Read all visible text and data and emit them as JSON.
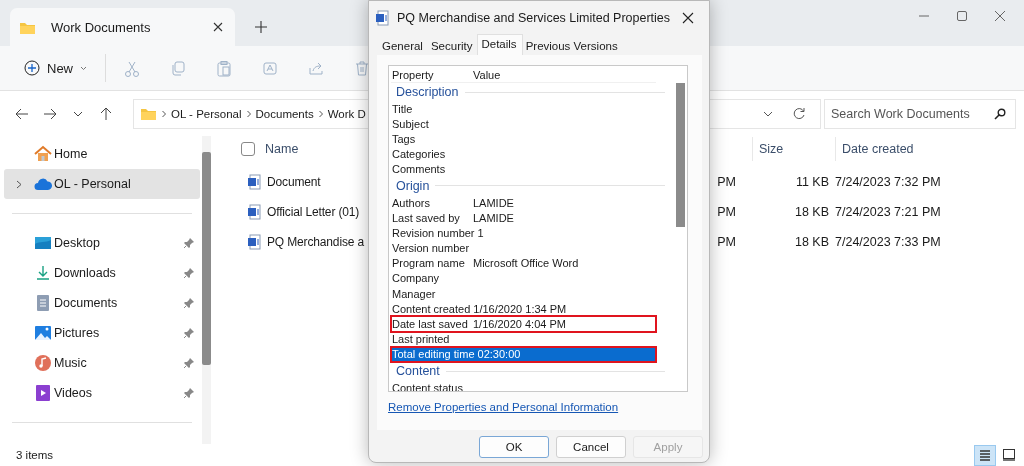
{
  "explorer": {
    "tab": {
      "title": "Work Documents"
    },
    "toolbar": {
      "new_label": "New",
      "actions": [
        {
          "kind": "cut",
          "disabled": true
        },
        {
          "kind": "copy",
          "disabled": true
        },
        {
          "kind": "paste",
          "disabled": true
        },
        {
          "kind": "rename",
          "disabled": true
        },
        {
          "kind": "share",
          "disabled": true
        },
        {
          "kind": "delete",
          "disabled": true
        }
      ]
    },
    "breadcrumbs": [
      "OL - Personal",
      "Documents",
      "Work D"
    ],
    "search": {
      "placeholder": "Search Work Documents"
    },
    "sidebar": {
      "sections": [
        {
          "items": [
            {
              "label": "Home",
              "kind": "home",
              "selected": false,
              "expandable": false,
              "pinned": false
            },
            {
              "label": "OL - Personal",
              "kind": "cloud",
              "selected": true,
              "expandable": true,
              "pinned": false
            }
          ]
        },
        {
          "items": [
            {
              "label": "Desktop",
              "kind": "desktop",
              "selected": false,
              "expandable": false,
              "pinned": true
            },
            {
              "label": "Downloads",
              "kind": "downloads",
              "selected": false,
              "expandable": false,
              "pinned": true
            },
            {
              "label": "Documents",
              "kind": "documents",
              "selected": false,
              "expandable": false,
              "pinned": true
            },
            {
              "label": "Pictures",
              "kind": "pictures",
              "selected": false,
              "expandable": false,
              "pinned": true
            },
            {
              "label": "Music",
              "kind": "music",
              "selected": false,
              "expandable": false,
              "pinned": true
            },
            {
              "label": "Videos",
              "kind": "videos",
              "selected": false,
              "expandable": false,
              "pinned": true
            }
          ]
        }
      ]
    },
    "columns": {
      "select_all_checked": false,
      "name": "Name",
      "size": "Size",
      "date_created": "Date created"
    },
    "files": [
      {
        "name": "Document",
        "date_modified": "PM",
        "size": "11 KB",
        "date_created": "7/24/2023 7:32 PM"
      },
      {
        "name": "Official Letter (01)",
        "date_modified": "PM",
        "size": "18 KB",
        "date_created": "7/24/2023 7:21 PM"
      },
      {
        "name": "PQ Merchandise a",
        "date_modified": "PM",
        "size": "18 KB",
        "date_created": "7/24/2023 7:33 PM"
      }
    ],
    "status_bar": "3 items",
    "views": [
      {
        "kind": "details",
        "selected": true
      },
      {
        "kind": "tiles",
        "selected": false
      }
    ]
  },
  "dialog": {
    "title": "PQ Merchandise and Services Limited Properties",
    "tabs": [
      {
        "label": "General",
        "selected": false
      },
      {
        "label": "Security",
        "selected": false
      },
      {
        "label": "Details",
        "selected": true
      },
      {
        "label": "Previous Versions",
        "selected": false
      }
    ],
    "properties": {
      "columns": [
        "Property",
        "Value"
      ],
      "rows": [
        {
          "kind": "group",
          "label": "Description"
        },
        {
          "kind": "property",
          "name": "Title",
          "selected": false,
          "highlighted": false
        },
        {
          "kind": "property",
          "name": "Subject",
          "selected": false,
          "highlighted": false
        },
        {
          "kind": "property",
          "name": "Tags",
          "selected": false,
          "highlighted": false
        },
        {
          "kind": "property",
          "name": "Categories",
          "selected": false,
          "highlighted": false
        },
        {
          "kind": "property",
          "name": "Comments",
          "selected": false,
          "highlighted": false
        },
        {
          "kind": "group",
          "label": "Origin"
        },
        {
          "kind": "property",
          "name": "Authors",
          "value": "LAMIDE",
          "selected": false,
          "highlighted": false
        },
        {
          "kind": "property",
          "name": "Last saved by",
          "value": "LAMIDE",
          "selected": false,
          "highlighted": false
        },
        {
          "kind": "property",
          "name": "Revision number",
          "value": "1",
          "selected": false,
          "highlighted": false
        },
        {
          "kind": "property",
          "name": "Version number",
          "selected": false,
          "highlighted": false
        },
        {
          "kind": "property",
          "name": "Program name",
          "value": "Microsoft Office Word",
          "selected": false,
          "highlighted": false
        },
        {
          "kind": "property",
          "name": "Company",
          "selected": false,
          "highlighted": false
        },
        {
          "kind": "property",
          "name": "Manager",
          "selected": false,
          "highlighted": false
        },
        {
          "kind": "property",
          "name": "Content created",
          "value": "1/16/2020 1:34 PM",
          "selected": false,
          "highlighted": false
        },
        {
          "kind": "property",
          "name": "Date last saved",
          "value": "1/16/2020 4:04 PM",
          "selected": false,
          "highlighted": true
        },
        {
          "kind": "property",
          "name": "Last printed",
          "selected": false,
          "highlighted": false
        },
        {
          "kind": "property",
          "name": "Total editing time",
          "value": "02:30:00",
          "selected": true,
          "highlighted": true
        },
        {
          "kind": "group",
          "label": "Content"
        },
        {
          "kind": "property",
          "name": "Content status",
          "selected": false,
          "highlighted": false
        }
      ]
    },
    "link": "Remove Properties and Personal Information",
    "buttons": [
      {
        "label": "OK",
        "default": true,
        "disabled": false
      },
      {
        "label": "Cancel",
        "default": false,
        "disabled": false
      },
      {
        "label": "Apply",
        "default": false,
        "disabled": true
      }
    ]
  }
}
